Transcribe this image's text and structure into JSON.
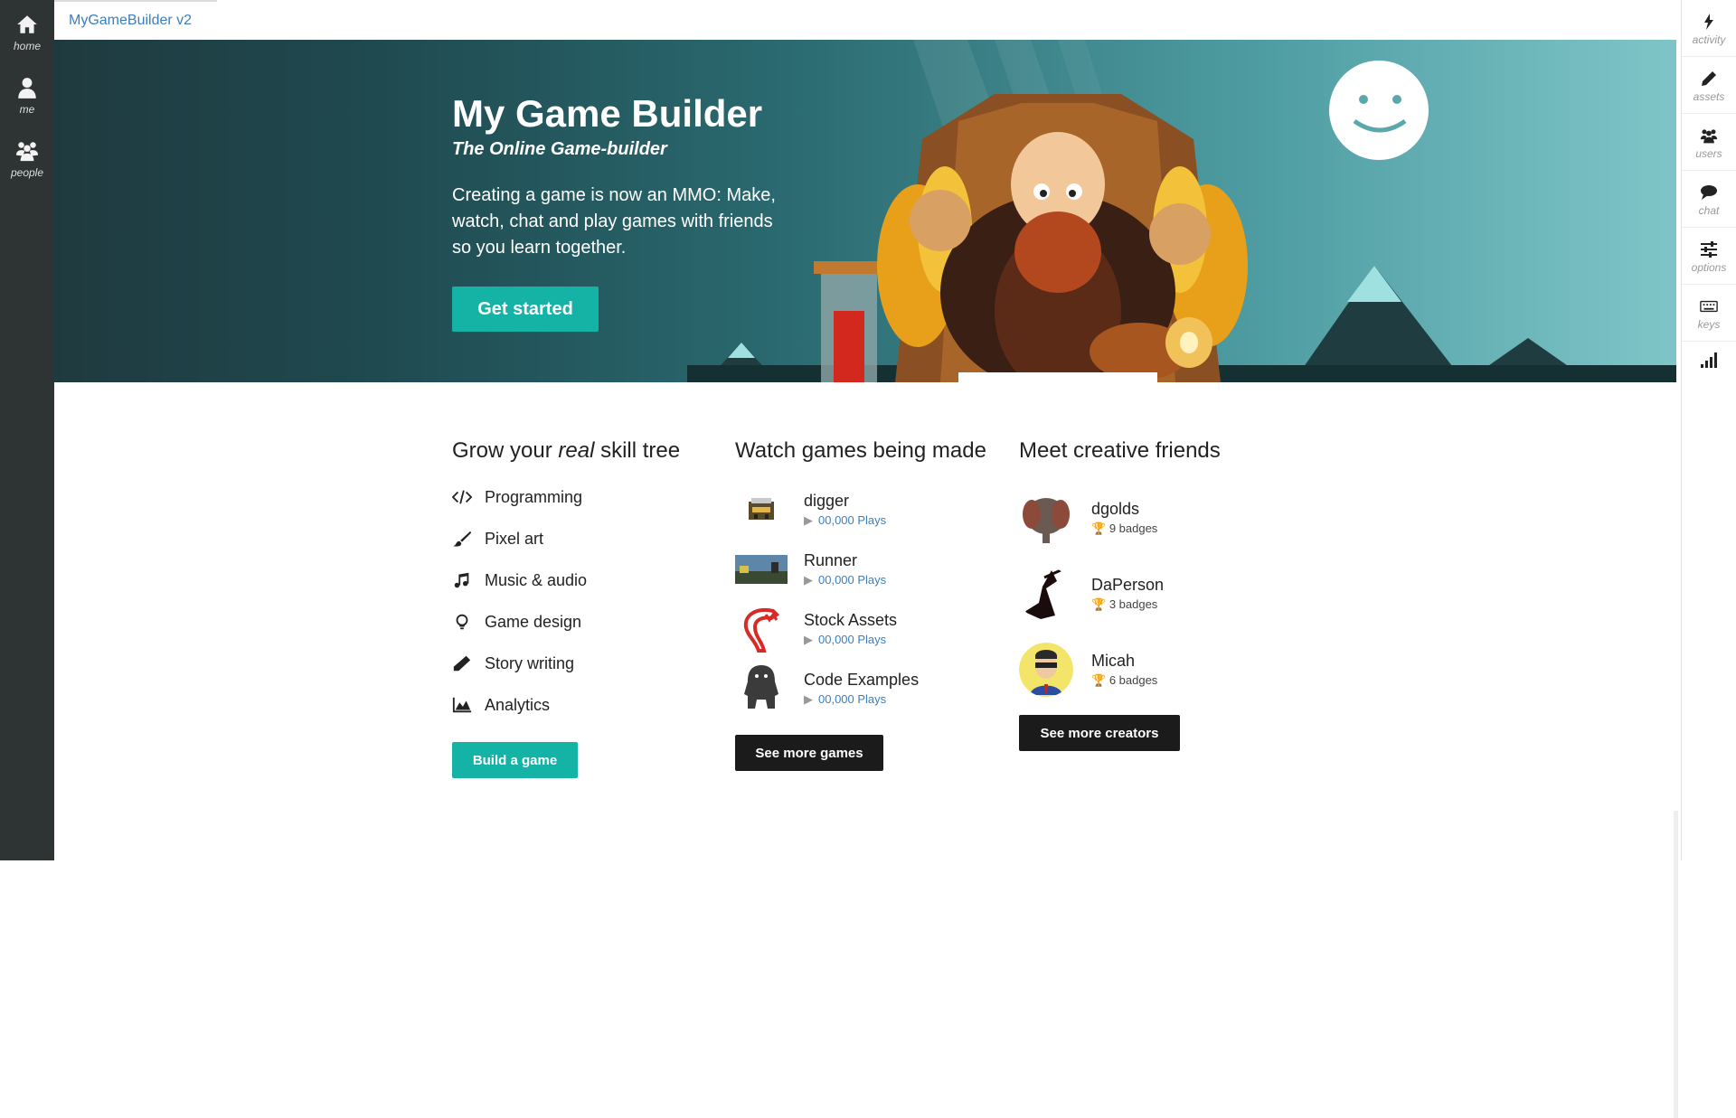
{
  "app": {
    "title": "MyGameBuilder v2"
  },
  "left_nav": [
    {
      "label": "home",
      "icon": "home-icon"
    },
    {
      "label": "me",
      "icon": "user-icon"
    },
    {
      "label": "people",
      "icon": "people-icon"
    }
  ],
  "right_nav": [
    {
      "label": "activity",
      "icon": "bolt-icon"
    },
    {
      "label": "assets",
      "icon": "pencil-icon"
    },
    {
      "label": "users",
      "icon": "users-icon"
    },
    {
      "label": "chat",
      "icon": "chat-icon"
    },
    {
      "label": "options",
      "icon": "sliders-icon"
    },
    {
      "label": "keys",
      "icon": "keyboard-icon"
    }
  ],
  "hero": {
    "title": "My Game Builder",
    "subtitle": "The Online Game-builder",
    "description": "Creating a game is now an MMO: Make, watch, chat and play games with friends so you learn together.",
    "cta": "Get started"
  },
  "skills": {
    "heading_pre": "Grow your ",
    "heading_em": "real",
    "heading_post": " skill tree",
    "items": [
      {
        "label": "Programming",
        "icon": "code-icon"
      },
      {
        "label": "Pixel art",
        "icon": "brush-icon"
      },
      {
        "label": "Music & audio",
        "icon": "music-icon"
      },
      {
        "label": "Game design",
        "icon": "lightbulb-icon"
      },
      {
        "label": "Story writing",
        "icon": "pencil-icon"
      },
      {
        "label": "Analytics",
        "icon": "area-chart-icon"
      }
    ],
    "button": "Build a game"
  },
  "games": {
    "heading": "Watch games being made",
    "items": [
      {
        "name": "digger",
        "plays": "00,000 Plays"
      },
      {
        "name": "Runner",
        "plays": "00,000 Plays"
      },
      {
        "name": "Stock Assets",
        "plays": "00,000 Plays"
      },
      {
        "name": "Code Examples",
        "plays": "00,000 Plays"
      }
    ],
    "button": "See more games"
  },
  "friends": {
    "heading": "Meet creative friends",
    "items": [
      {
        "name": "dgolds",
        "badges": "9 badges"
      },
      {
        "name": "DaPerson",
        "badges": "3 badges"
      },
      {
        "name": "Micah",
        "badges": "6 badges"
      }
    ],
    "button": "See more creators"
  },
  "colors": {
    "teal": "#15b2a6",
    "dark": "#1b1b1b",
    "link": "#3b7fbf",
    "nav": "#2e3333"
  }
}
